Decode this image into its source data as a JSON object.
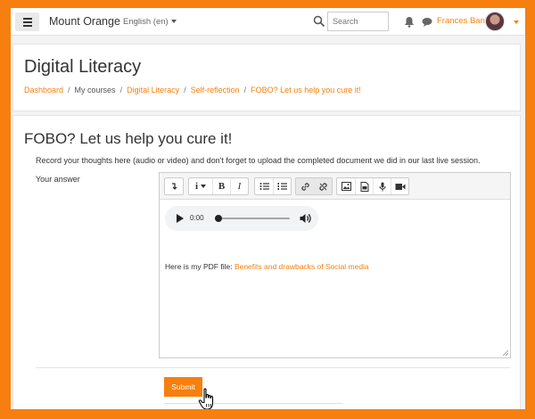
{
  "navbar": {
    "site_name": "Mount Orange",
    "language": "English (en)",
    "search_placeholder": "Search",
    "user_name": "Frances Banks"
  },
  "header": {
    "title": "Digital Literacy",
    "breadcrumb": [
      "Dashboard",
      "My courses",
      "Digital Literacy",
      "Self-reflection",
      "FOBO? Let us help you cure it!"
    ]
  },
  "question": {
    "title": "FOBO? Let us help you cure it!",
    "instructions": "Record your thoughts here (audio or video) and don't forget to upload the completed document we did in our last live session.",
    "answer_label": "Your answer"
  },
  "editor": {
    "toolbar": {
      "format_label": "1̲",
      "info_label": "i",
      "bold_label": "B",
      "italic_label": "I"
    },
    "audio_time": "0:00",
    "pdf_prefix": "Here is my PDF file: ",
    "pdf_link": "Benefits and drawbacks of Social media"
  },
  "actions": {
    "submit_label": "Submit"
  },
  "colors": {
    "accent": "#f77f0f"
  }
}
